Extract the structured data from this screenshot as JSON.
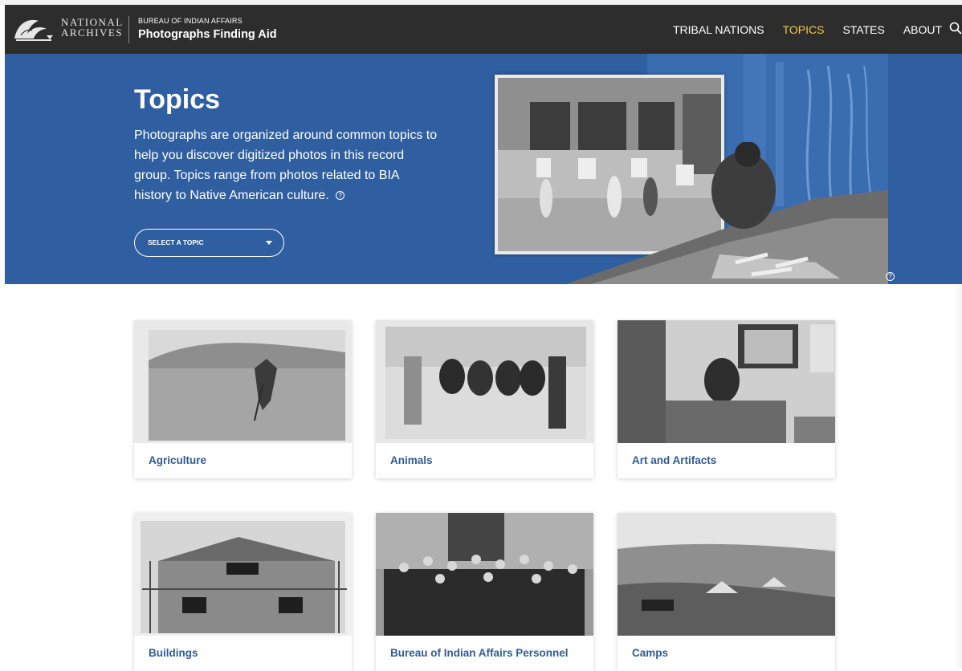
{
  "header": {
    "logo_text_line1": "NATIONAL",
    "logo_text_line2": "ARCHIVES",
    "subtitle": "BUREAU OF INDIAN AFFAIRS",
    "title": "Photographs Finding Aid",
    "nav": [
      {
        "label": "TRIBAL NATIONS",
        "active": false
      },
      {
        "label": "TOPICS",
        "active": true
      },
      {
        "label": "STATES",
        "active": false
      },
      {
        "label": "ABOUT",
        "active": false
      }
    ],
    "search_icon": "search-icon",
    "accent_color": "#f5c84b"
  },
  "hero": {
    "title": "Topics",
    "description": "Photographs are organized around common topics to help you discover digitized photos in this record group. Topics range from photos related to BIA history to Native American culture.",
    "help_icon": "help-circle-icon",
    "select_label": "SELECT A TOPIC",
    "background_color": "#2f5fa0"
  },
  "topics": [
    {
      "label": "Agriculture"
    },
    {
      "label": "Animals"
    },
    {
      "label": "Art and Artifacts"
    },
    {
      "label": "Buildings"
    },
    {
      "label": "Bureau of Indian Affairs Personnel"
    },
    {
      "label": "Camps"
    }
  ],
  "colors": {
    "card_title": "#2f5b96",
    "navbar": "#2d2d2d"
  }
}
